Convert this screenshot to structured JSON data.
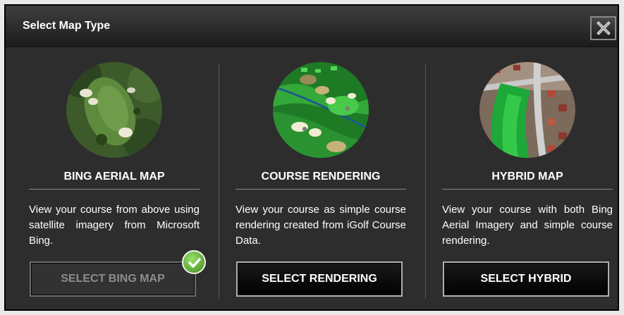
{
  "dialog": {
    "title": "Select Map Type",
    "close_icon": "close-x-icon"
  },
  "options": [
    {
      "title": "BING AERIAL MAP",
      "description": "View your course from above using satellite imagery from Microsoft Bing.",
      "button_label": "SELECT BING MAP",
      "selected": true,
      "image_icon": "aerial-map-thumbnail",
      "badge_icon": "checkmark-icon"
    },
    {
      "title": "COURSE RENDERING",
      "description": "View your course as simple course rendering created from iGolf Course Data.",
      "button_label": "SELECT RENDERING",
      "selected": false,
      "image_icon": "course-rendering-thumbnail"
    },
    {
      "title": "HYBRID MAP",
      "description": "View your course with both Bing Aerial Imagery and simple course rendering.",
      "button_label": "SELECT HYBRID",
      "selected": false,
      "image_icon": "hybrid-map-thumbnail"
    }
  ],
  "colors": {
    "dialog_bg": "#2d2d2d",
    "selected_badge": "#5aa534",
    "disabled_text": "#8c8c8c"
  }
}
